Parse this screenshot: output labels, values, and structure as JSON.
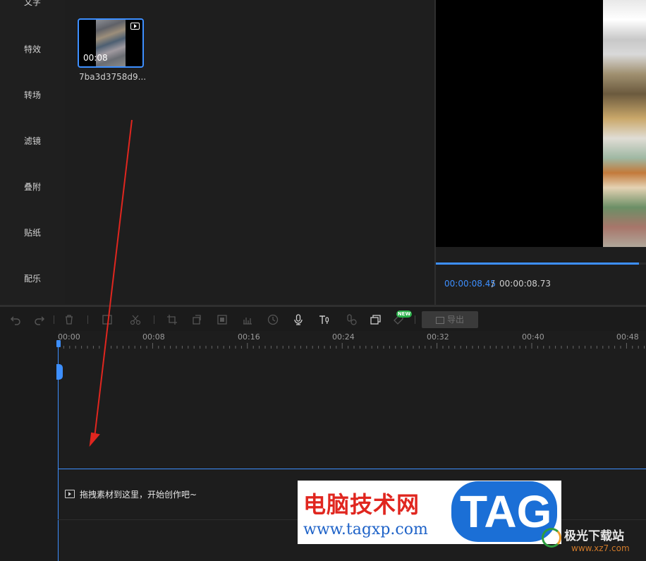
{
  "sidebar": {
    "items": [
      {
        "label": "文字"
      },
      {
        "label": "特效"
      },
      {
        "label": "转场"
      },
      {
        "label": "滤镜"
      },
      {
        "label": "叠附"
      },
      {
        "label": "贴纸"
      },
      {
        "label": "配乐"
      }
    ]
  },
  "media": {
    "clip": {
      "duration": "00:08",
      "name": "7ba3d3758d9..."
    }
  },
  "preview": {
    "current_time": "00:00:08.45",
    "separator": "/",
    "total_time": "00:00:08.73",
    "progress": 0.968
  },
  "toolbar": {
    "icons": [
      "undo-icon",
      "redo-icon",
      "delete-icon",
      "split-icon",
      "cut-icon",
      "crop-icon",
      "rotate-icon",
      "mosaic-icon",
      "audio-icon",
      "speed-icon",
      "microphone-icon",
      "text-to-speech-icon",
      "speech-to-text-icon",
      "layers-icon",
      "ai-icon"
    ],
    "new_badge": "NEW",
    "export_label": "导出"
  },
  "timeline": {
    "ruler_labels": [
      "00:00",
      "00:08",
      "00:16",
      "00:24",
      "00:32",
      "00:40",
      "00:48"
    ],
    "drop_hint": "拖拽素材到这里，开始创作吧~"
  },
  "watermark": {
    "site_cn": "电脑技术网",
    "site_url": "www.tagxp.com",
    "tag": "TAG",
    "site2_cn": "极光下载站",
    "site2_url": "www.xz7.com"
  },
  "colors": {
    "accent": "#3d8fff",
    "arrow": "#e0261f",
    "badge": "#2ab24a"
  }
}
